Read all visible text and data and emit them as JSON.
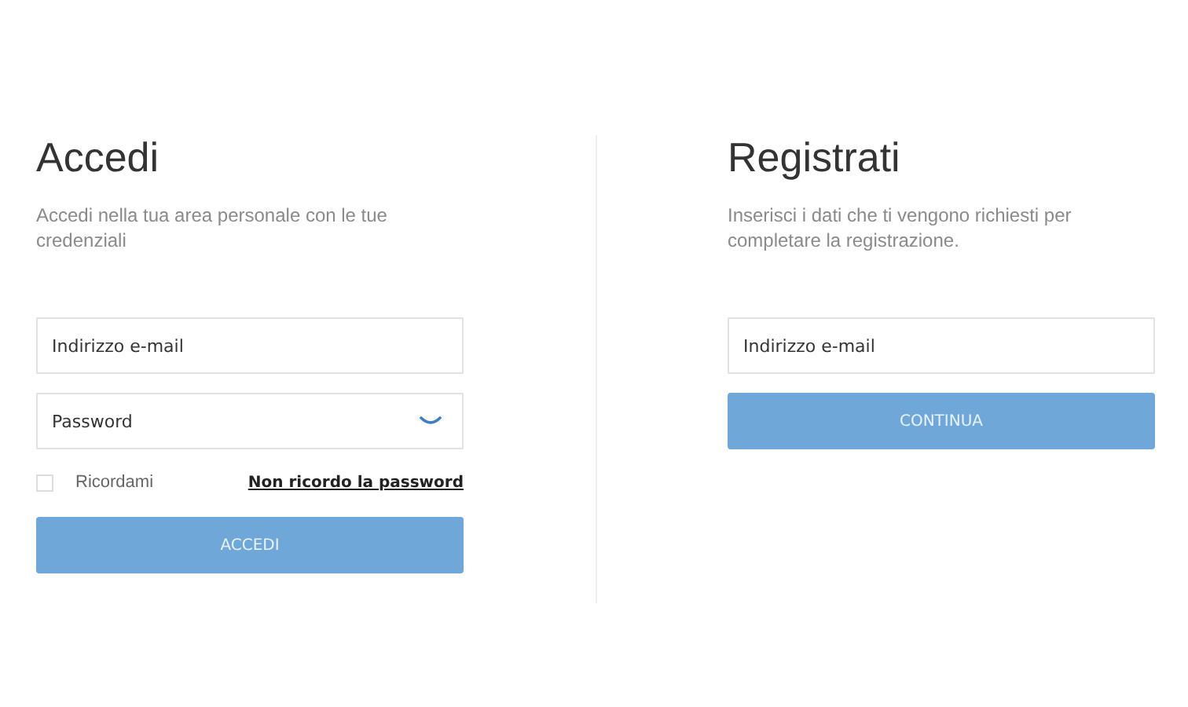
{
  "login": {
    "title": "Accedi",
    "subtitle": "Accedi nella tua area personale con le tue credenziali",
    "email": {
      "placeholder": "Indirizzo e-mail"
    },
    "password": {
      "placeholder": "Password"
    },
    "remember": {
      "label": "Ricordami",
      "checked": false
    },
    "forgot_link": "Non ricordo la password",
    "button": "ACCEDI"
  },
  "register": {
    "title": "Registrati",
    "subtitle": "Inserisci i dati che ti vengono richiesti per completare la registrazione.",
    "email": {
      "placeholder": "Indirizzo e-mail"
    },
    "button": "CONTINUA"
  }
}
